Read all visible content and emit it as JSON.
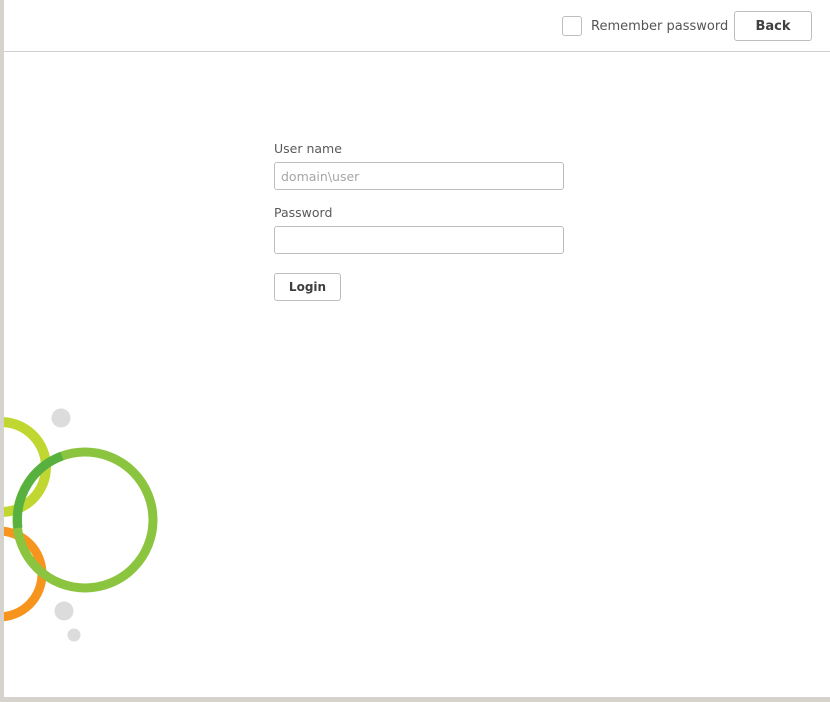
{
  "header": {
    "remember_password_label": "Remember password",
    "remember_password_checked": false,
    "back_label": "Back"
  },
  "login_form": {
    "username_label": "User name",
    "username_placeholder": "domain\\user",
    "username_value": "",
    "password_label": "Password",
    "password_value": "",
    "login_label": "Login"
  },
  "decoration": {
    "colors": {
      "lime_green": "#bfd730",
      "green": "#6cb33f",
      "orange": "#f7941d",
      "dot_gray": "#dcdcdc"
    }
  }
}
